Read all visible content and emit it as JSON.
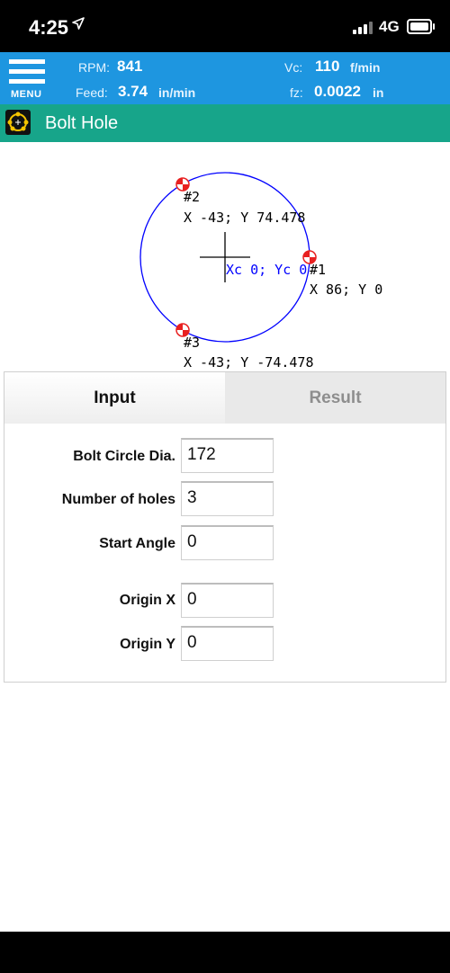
{
  "status": {
    "time": "4:25",
    "location_icon": "location-arrow-icon",
    "network": "4G"
  },
  "header": {
    "menu_label": "MENU",
    "rpm": {
      "label": "RPM:",
      "value": "841"
    },
    "feed": {
      "label": "Feed:",
      "value": "3.74",
      "unit": "in/min"
    },
    "vc": {
      "label": "Vc:",
      "value": "110",
      "unit": "f/min"
    },
    "fz": {
      "label": "fz:",
      "value": "0.0022",
      "unit": "in"
    }
  },
  "title": "Bolt Hole",
  "diagram": {
    "center_label": "Xc 0; Yc 0",
    "holes": [
      {
        "id": "#1",
        "coords": "X 86; Y 0"
      },
      {
        "id": "#2",
        "coords": "X -43; Y 74.478"
      },
      {
        "id": "#3",
        "coords": "X -43; Y -74.478"
      }
    ],
    "colors": {
      "circle": "#0000ff",
      "center_text": "#0000ff",
      "marker": "#e82020"
    }
  },
  "tabs": {
    "input": "Input",
    "result": "Result"
  },
  "form": {
    "bolt_circle_dia": {
      "label": "Bolt Circle Dia.",
      "value": "172"
    },
    "number_of_holes": {
      "label": "Number of holes",
      "value": "3"
    },
    "start_angle": {
      "label": "Start Angle",
      "value": "0"
    },
    "origin_x": {
      "label": "Origin X",
      "value": "0"
    },
    "origin_y": {
      "label": "Origin Y",
      "value": "0"
    }
  },
  "theme": {
    "header_blue": "#1e96e0",
    "title_teal": "#17a58a"
  }
}
